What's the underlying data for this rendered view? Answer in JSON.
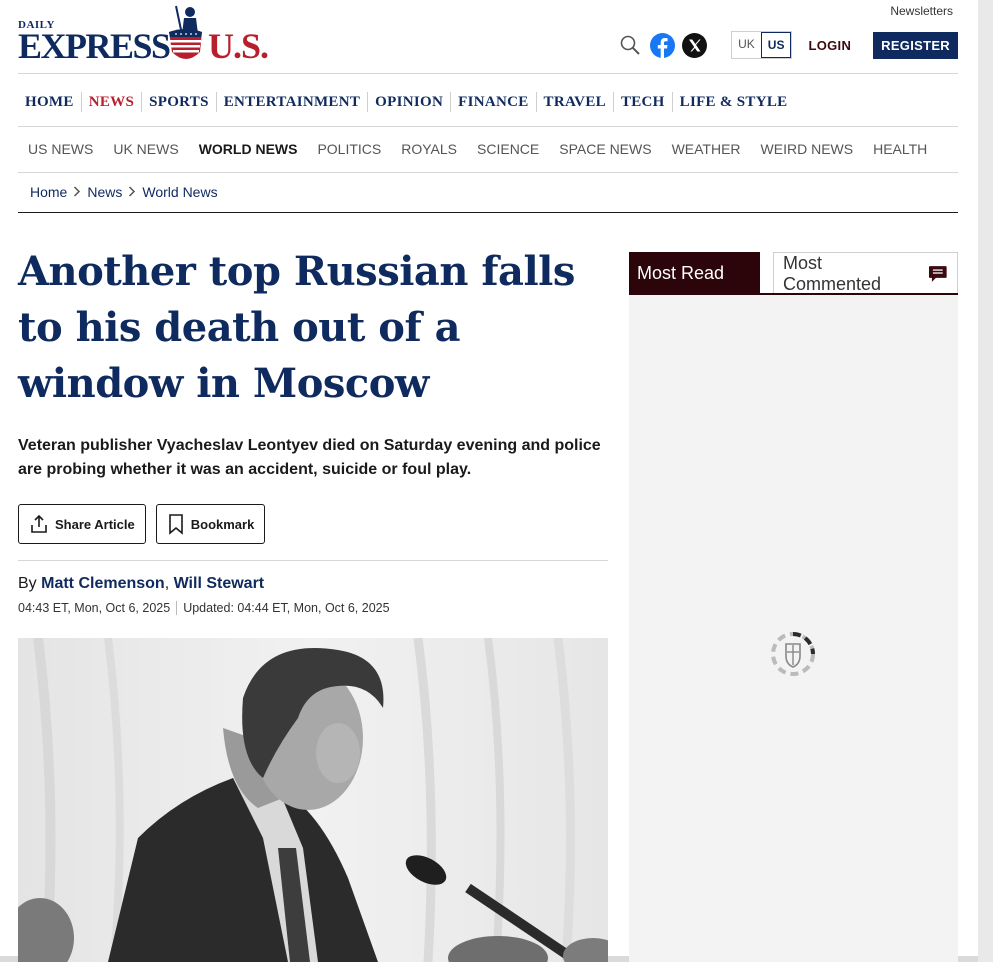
{
  "header": {
    "newsletters": "Newsletters",
    "logo": {
      "daily": "DAILY",
      "express": "EXPRESS",
      "us": "U.S."
    },
    "edition": {
      "uk": "UK",
      "us": "US",
      "selected": "US"
    },
    "login": "LOGIN",
    "register": "REGISTER",
    "icons": [
      "search-icon",
      "facebook-icon",
      "x-icon"
    ]
  },
  "main_nav": [
    "HOME",
    "NEWS",
    "SPORTS",
    "ENTERTAINMENT",
    "OPINION",
    "FINANCE",
    "TRAVEL",
    "TECH",
    "LIFE & STYLE"
  ],
  "main_nav_active": "NEWS",
  "sub_nav": [
    "US NEWS",
    "UK NEWS",
    "WORLD NEWS",
    "POLITICS",
    "ROYALS",
    "SCIENCE",
    "SPACE NEWS",
    "WEATHER",
    "WEIRD NEWS",
    "HEALTH"
  ],
  "sub_nav_active": "WORLD NEWS",
  "breadcrumb": [
    "Home",
    "News",
    "World News"
  ],
  "article": {
    "headline": "Another top Russian falls to his death out of a window in Moscow",
    "standfirst": "Veteran publisher Vyacheslav Leontyev died on Saturday evening and police are probing whether it was an accident, suicide or foul play.",
    "share_label": "Share Article",
    "bookmark_label": "Bookmark",
    "by": "By",
    "authors": [
      "Matt Clemenson",
      "Will Stewart"
    ],
    "published": "04:43 ET, Mon, Oct 6, 2025",
    "updated": "Updated: 04:44 ET, Mon, Oct 6, 2025"
  },
  "sidebar": {
    "tab_most_read": "Most Read",
    "tab_most_commented": "Most Commented"
  },
  "colors": {
    "brand_navy": "#0e2a5e",
    "brand_red": "#b71f2d",
    "dark_maroon": "#2b0509"
  }
}
